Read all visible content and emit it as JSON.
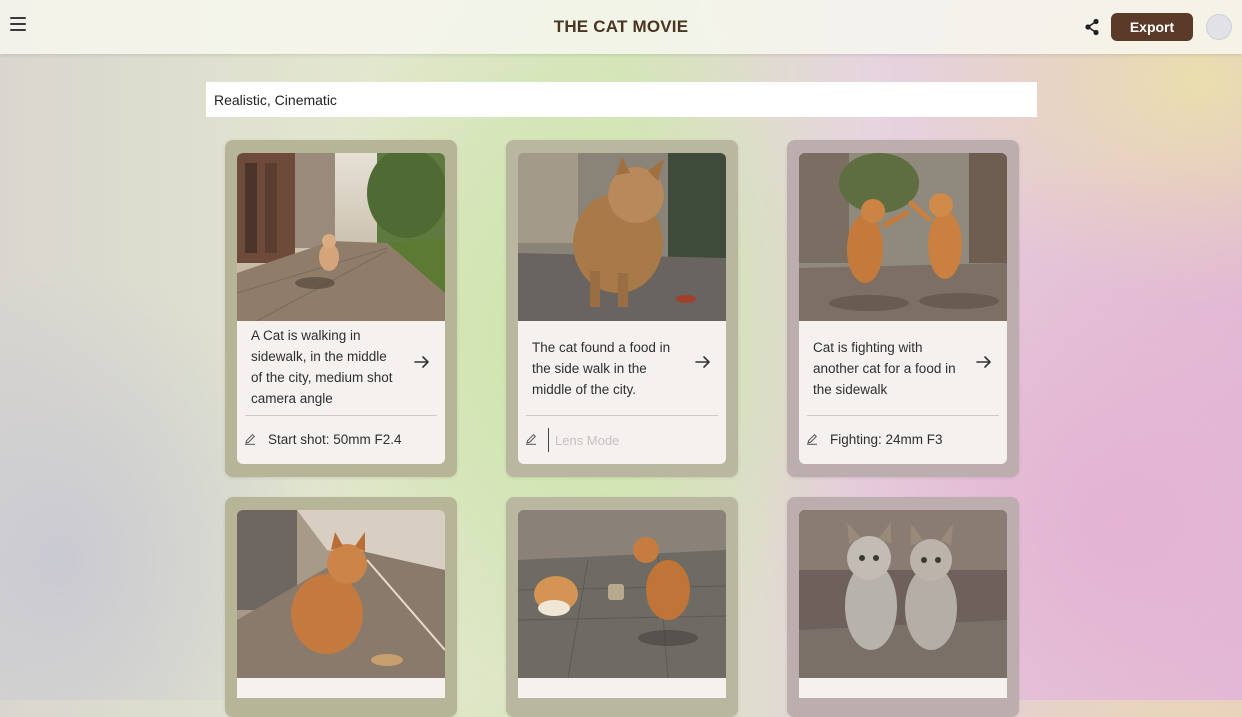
{
  "header": {
    "title": "THE CAT MOVIE",
    "export_label": "Export"
  },
  "style_field": {
    "value": "Realistic, Cinematic"
  },
  "shots": [
    {
      "description": "A Cat is walking in sidewalk, in the middle of the city, medium shot camera angle",
      "note": "Start shot: 50mm F2.4"
    },
    {
      "description": "The cat found a food in the side walk in the middle of the city.",
      "note": "",
      "note_placeholder": "Lens Mode"
    },
    {
      "description": "Cat is fighting with another cat for a food in the sidewalk",
      "note": "Fighting: 24mm F3"
    }
  ],
  "colors": {
    "accent": "#5c3a2a",
    "title": "#4a3520"
  }
}
